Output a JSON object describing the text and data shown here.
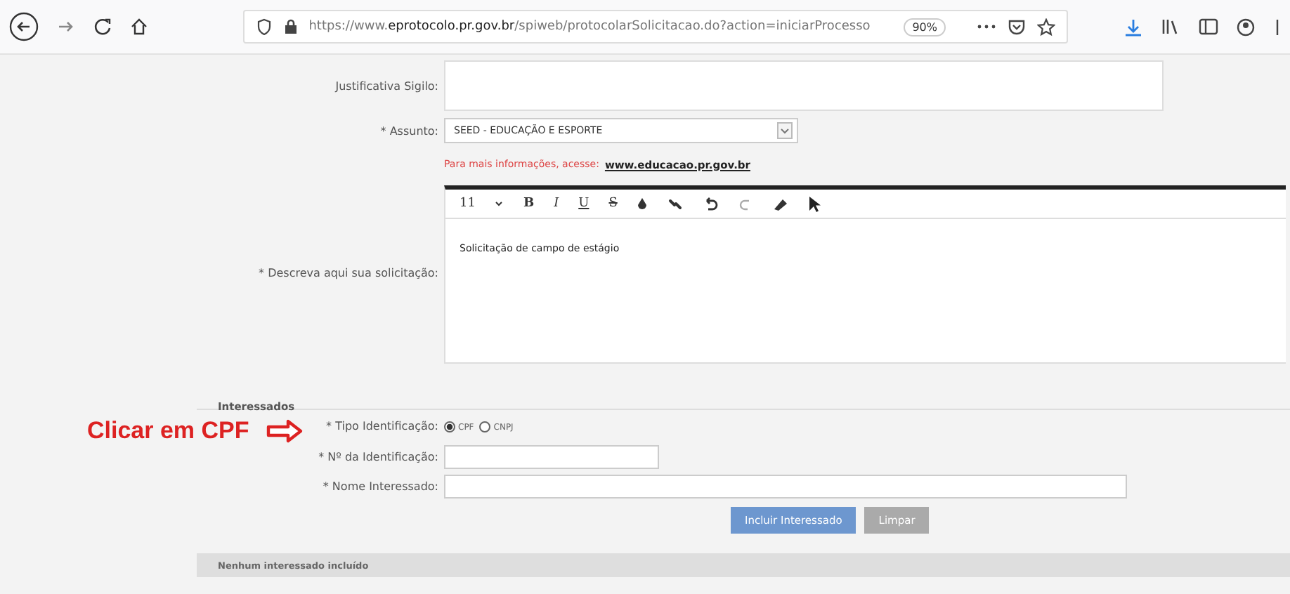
{
  "browser": {
    "url": "https://www.**eprotocolo.pr.gov.br**/spiweb/protocolarSolicitacao.do?action=iniciarProcesso",
    "zoom": "90%"
  },
  "form": {
    "justificativa_label": "Justificativa Sigilo:",
    "assunto_label": "* Assunto:",
    "assunto_value": "SEED - EDUCAÇÃO E ESPORTE",
    "info_text": "Para mais informações, acesse:",
    "info_link": "www.educacao.pr.gov.br",
    "descricao_label": "* Descreva aqui sua solicitação:",
    "editor_toolbar": {
      "font_size": "11",
      "bold": "B",
      "italic": "I",
      "underline": "U",
      "strike": "S"
    },
    "editor_text": "Solicitação de campo de estágio"
  },
  "interessados": {
    "title": "Interessados",
    "tipo_label": "* Tipo Identificação:",
    "options": [
      {
        "label": "CPF",
        "selected": true
      },
      {
        "label": "CNPJ",
        "selected": false
      }
    ],
    "numero_label": "* Nº da Identificação:",
    "nome_label": "* Nome Interessado:",
    "buttons": [
      {
        "label": "Incluir Interessado",
        "kind": "primary"
      },
      {
        "label": "Limpar",
        "kind": "secondary"
      }
    ],
    "empty_text": "Nenhum interessado incluído"
  },
  "annotation": {
    "text": "Clicar em CPF"
  }
}
